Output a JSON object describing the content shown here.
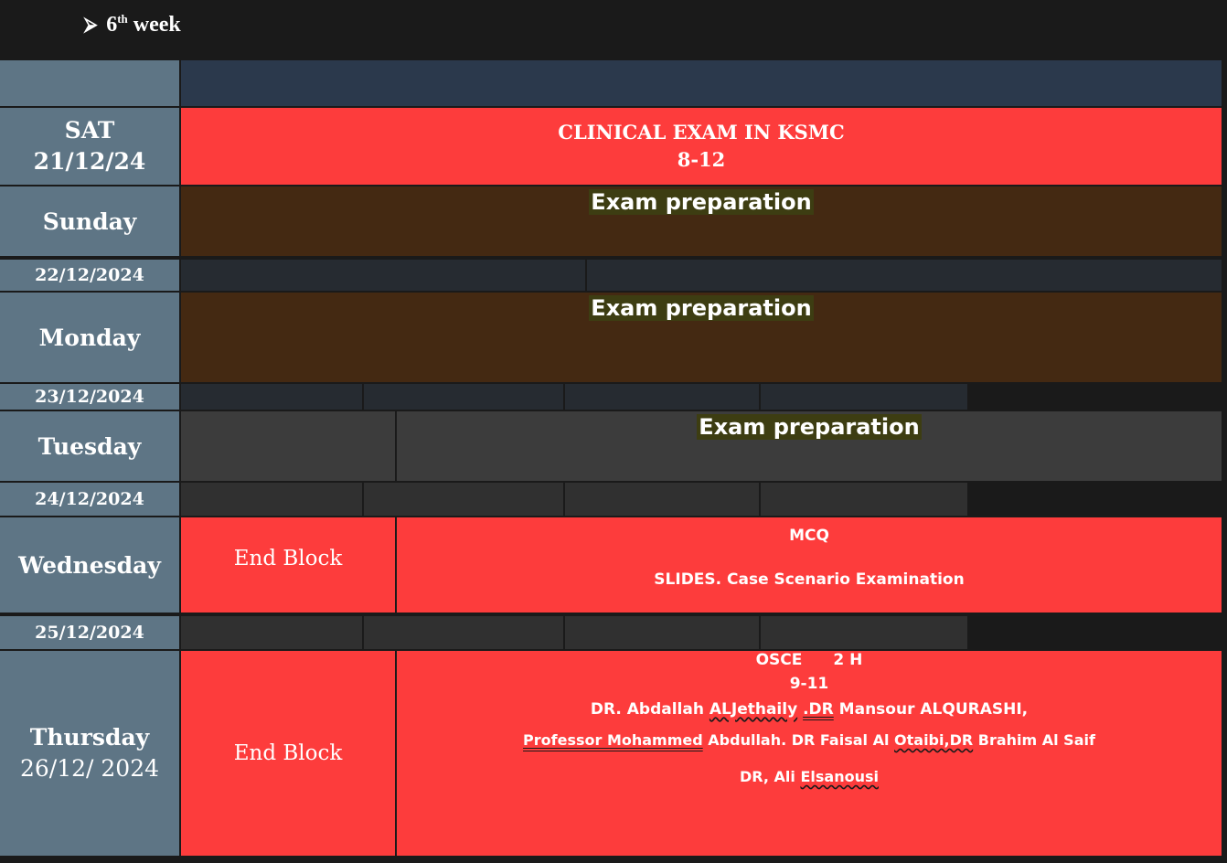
{
  "header": {
    "arrow": "⮚",
    "week_number": "6",
    "week_suffix": "th",
    "week_label": "week"
  },
  "sat": {
    "day": "SAT",
    "date": "21/12/24",
    "event_line1": "CLINICAL EXAM IN KSMC",
    "event_line2": "8-12"
  },
  "sunday": {
    "day": "Sunday",
    "event": "Exam preparation",
    "date": "22/12/2024"
  },
  "monday": {
    "day": "Monday",
    "event": "Exam preparation",
    "date": "23/12/2024"
  },
  "tuesday": {
    "day": "Tuesday",
    "event": "Exam preparation",
    "date": "24/12/2024"
  },
  "wednesday": {
    "day": "Wednesday",
    "end_block": "End Block",
    "line1": "MCQ",
    "line2": "SLIDES. Case Scenario Examination",
    "date": "25/12/2024"
  },
  "thursday": {
    "day": "Thursday",
    "date": "26/12/ 2024",
    "end_block": "End Block",
    "osce": "OSCE",
    "duration": "2 H",
    "time": "9-11",
    "line1_a": "DR. Abdallah ",
    "line1_b": "ALJethaily",
    "line1_c": " ",
    "line1_d": ".DR",
    "line1_e": " Mansour ALQURASHI,",
    "line2_a": "Professor  Mohammed",
    "line2_b": " Abdullah. DR Faisal Al ",
    "line2_c": "Otaibi,DR",
    "line2_d": " Brahim Al Saif",
    "line3_a": "DR, Ali ",
    "line3_b": "Elsanousi"
  },
  "colors": {
    "day_cell": "#5e7585",
    "exam_red": "#fd3c3c",
    "prep_brown": "#442912",
    "highlight": "#3d3d12",
    "header_navy": "#2b394c"
  }
}
